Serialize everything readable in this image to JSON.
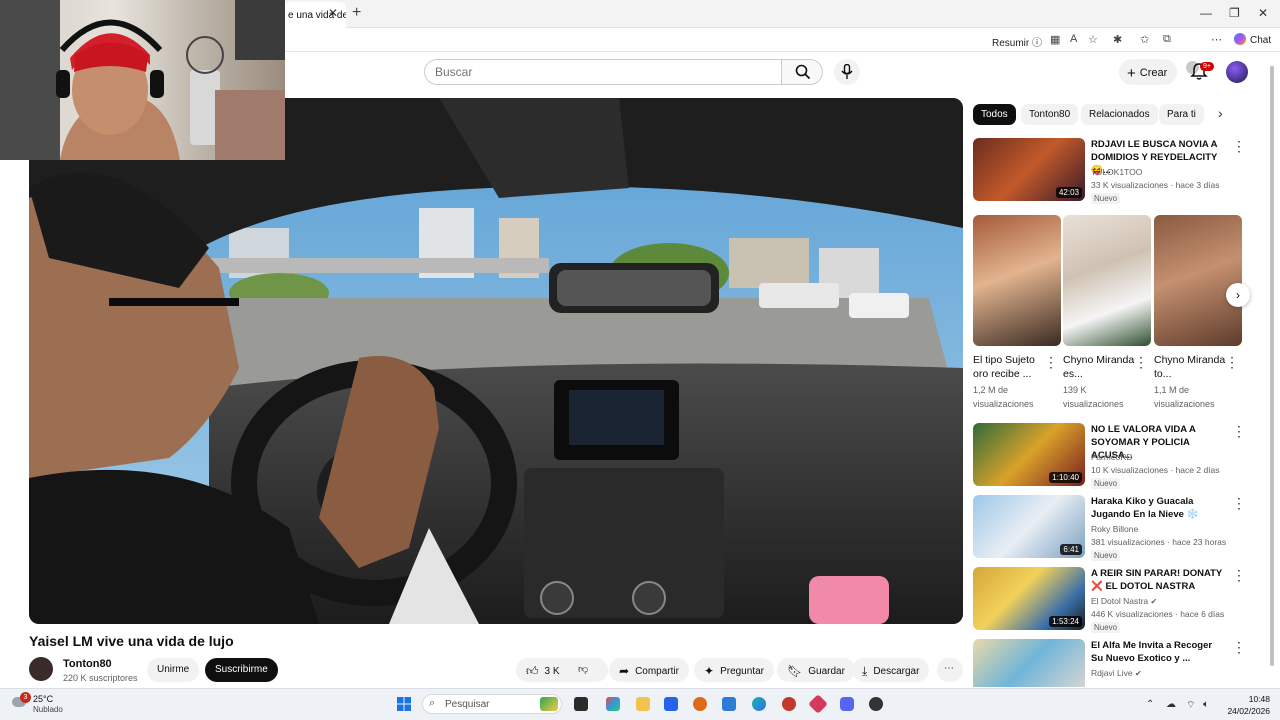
{
  "browser": {
    "tab_title": "e una vida de",
    "toolbar_resumir": "Resumir",
    "chat_label": "Chat"
  },
  "header": {
    "search_placeholder": "Buscar",
    "create_label": "Crear",
    "notifications_badge": "9+"
  },
  "video": {
    "title": "Yaisel LM vive una vida de lujo",
    "channel_name": "Tonton80",
    "channel_subs": "220 K suscriptores",
    "join_label": "Unirme",
    "subscribe_label": "Suscribirme",
    "like_count": "3 K",
    "share_label": "Compartir",
    "ask_label": "Preguntar",
    "save_label": "Guardar",
    "download_label": "Descargar"
  },
  "chips": [
    "Todos",
    "Tonton80",
    "Relacionados",
    "Para ti"
  ],
  "recommendations": [
    {
      "title": "RDJAVI LE BUSCA NOVIA A DOMIDIOS Y REYDELACITY😝...",
      "channel": "TULOK1TOO",
      "stats": "33 K visualizaciones · hace 3 días",
      "badge": "Nuevo",
      "duration": "42:03"
    },
    {
      "title": "NO LE VALORA VIDA A SOYOMAR Y POLICIA ACUSA...",
      "channel": "FarmeoRD",
      "stats": "10 K visualizaciones · hace 2 días",
      "badge": "Nuevo",
      "duration": "1:10:40"
    },
    {
      "title": "Haraka Kiko y Guacala Jugando En la Nieve ❄️",
      "channel": "Roky Billone",
      "stats": "381 visualizaciones · hace 23 horas",
      "badge": "Nuevo",
      "duration": "6:41"
    },
    {
      "title": "A REIR SIN PARAR! DONATY ❌ EL DOTOL NASTRA",
      "channel": "El Dotol Nastra",
      "stats": "446 K visualizaciones · hace 6 días",
      "badge": "Nuevo",
      "duration": "1:53:24"
    },
    {
      "title": "El Alfa Me Invita a Recoger Su Nuevo Exotico y ...",
      "channel": "Rdjavi Live",
      "stats": "",
      "badge": "",
      "duration": ""
    }
  ],
  "shorts": [
    {
      "title": "El tipo Sujeto oro recibe ...",
      "stats": "1,2 M de visualizaciones"
    },
    {
      "title": "Chyno Miranda es...",
      "stats": "139 K visualizaciones"
    },
    {
      "title": "Chyno Miranda to...",
      "stats": "1,1 M de visualizaciones"
    }
  ],
  "taskbar": {
    "weather_temp": "25°C",
    "weather_desc": "Nublado",
    "weather_badge": "3",
    "search_placeholder": "Pesquisar",
    "time": "10:48",
    "date": "24/02/2026"
  }
}
